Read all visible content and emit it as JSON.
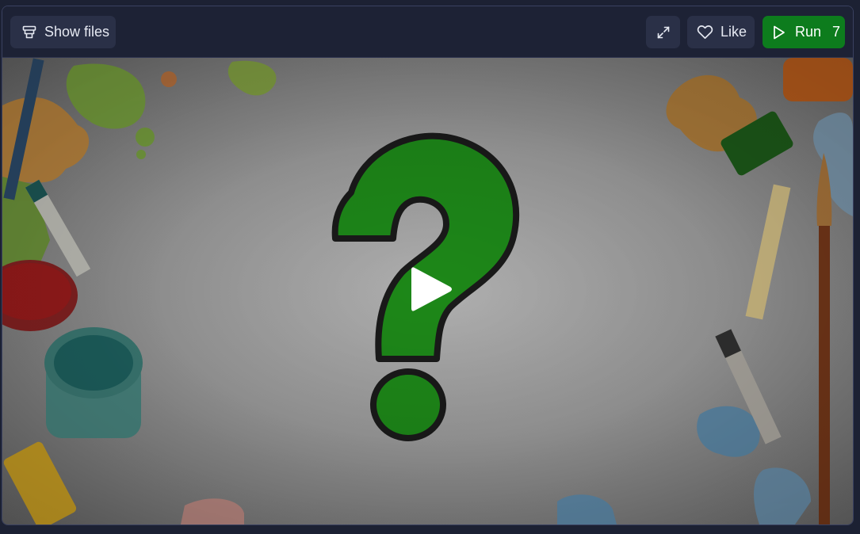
{
  "toolbar": {
    "show_files_label": "Show files",
    "like_label": "Like",
    "run_label": "Run",
    "run_count": "7"
  },
  "colors": {
    "run_button": "#0d7c1d",
    "toolbar_bg": "#1d2235",
    "button_bg": "#2a3047",
    "question_mark": "#1e9a1a"
  },
  "icons": {
    "show_files": "files-stack-icon",
    "expand": "expand-icon",
    "like": "heart-icon",
    "run": "play-outline-icon",
    "preview_play": "play-icon"
  }
}
